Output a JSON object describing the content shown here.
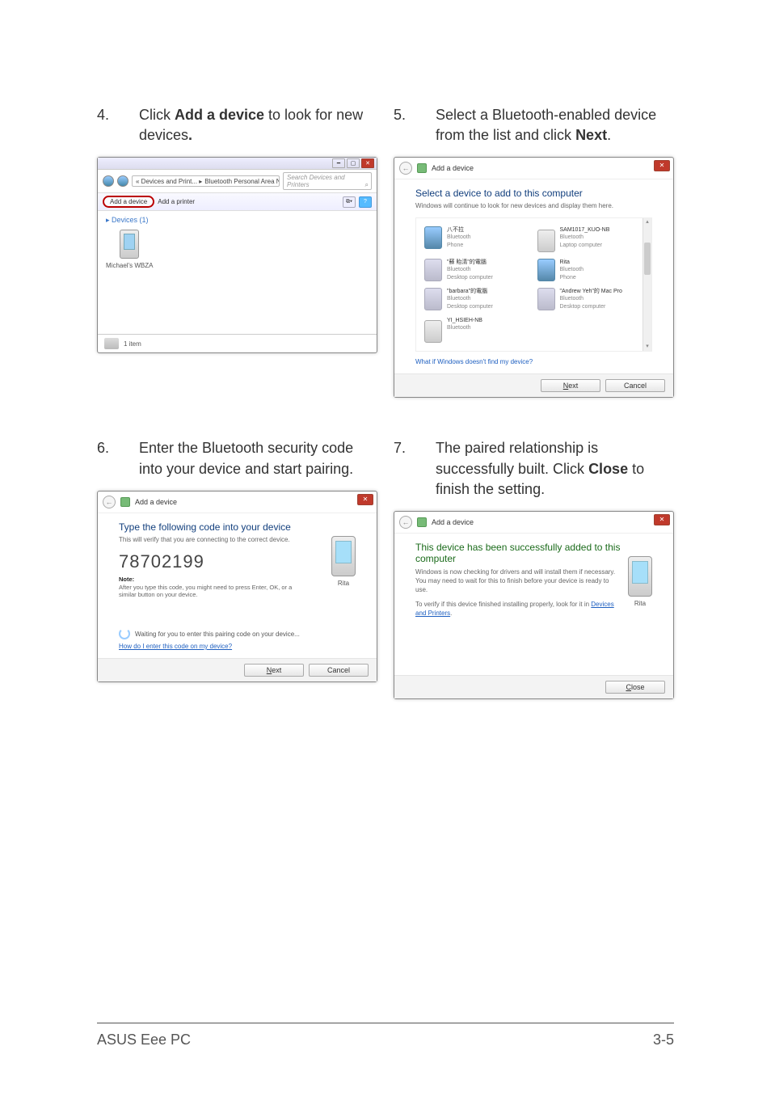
{
  "steps": {
    "s4": {
      "num": "4.",
      "pre": "Click ",
      "bold": "Add a device",
      "post": " to look for new devices",
      "punct": "."
    },
    "s5": {
      "num": "5.",
      "pre": "Select a Bluetooth-enabled device from the list and click ",
      "bold": "Next",
      "post": "."
    },
    "s6": {
      "num": "6.",
      "text": "Enter the Bluetooth security code into your device and start pairing."
    },
    "s7": {
      "num": "7.",
      "pre": "The paired relationship is successfully built. Click ",
      "bold": "Close",
      "post": " to finish the setting."
    }
  },
  "window4": {
    "breadcrumb_prefix": "« Devices and Print... ▸",
    "breadcrumb_item": "Bluetooth Personal Area Network Devices",
    "search_placeholder": "Search Devices and Printers",
    "toolbar_add_device": "Add a device",
    "toolbar_add_printer": "Add a printer",
    "devices_header": "▸ Devices (1)",
    "device_name": "Michael's WBZA",
    "status": "1 item"
  },
  "dialog5": {
    "title": "Add a device",
    "heading": "Select a device to add to this computer",
    "sub": "Windows will continue to look for new devices and display them here.",
    "help_link": "What if Windows doesn't find my device?",
    "next": "Next",
    "cancel": "Cancel",
    "devices": [
      {
        "l1": "八不拉",
        "l2": "Bluetooth",
        "l3": "Phone",
        "ico": "ico-phone"
      },
      {
        "l1": "SAM1017_KUO-NB",
        "l2": "Bluetooth",
        "l3": "Laptop computer",
        "ico": "ico-laptop"
      },
      {
        "l1": "\"蘇 貽清\"的電腦",
        "l2": "Bluetooth",
        "l3": "Desktop computer",
        "ico": "ico-desktop"
      },
      {
        "l1": "Rita",
        "l2": "Bluetooth",
        "l3": "Phone",
        "ico": "ico-phone"
      },
      {
        "l1": "\"barbara\"的電腦",
        "l2": "Bluetooth",
        "l3": "Desktop computer",
        "ico": "ico-desktop"
      },
      {
        "l1": "\"Andrew Yeh\"的 Mac Pro",
        "l2": "Bluetooth",
        "l3": "Desktop computer",
        "ico": "ico-desktop"
      },
      {
        "l1": "YI_HSIEH-NB",
        "l2": "Bluetooth",
        "l3": "",
        "ico": "ico-laptop"
      }
    ]
  },
  "dialog6": {
    "title": "Add a device",
    "heading": "Type the following code into your device",
    "sub": "This will verify that you are connecting to the correct device.",
    "code": "78702199",
    "note_label": "Note:",
    "note_text": "After you type this code, you might need to press Enter, OK, or a similar button on your device.",
    "waiting": "Waiting for you to enter this pairing code on your device...",
    "help_link": "How do I enter this code on my device?",
    "device_name": "Rita",
    "next": "Next",
    "cancel": "Cancel"
  },
  "dialog7": {
    "title": "Add a device",
    "heading": "This device has been successfully added to this computer",
    "info1": "Windows is now checking for drivers and will install them if necessary. You may need to wait for this to finish before your device is ready to use.",
    "info2_pre": "To verify if this device finished installing properly, look for it in ",
    "info2_link": "Devices and Printers",
    "device_name": "Rita",
    "close": "Close"
  },
  "footer": {
    "left": "ASUS Eee PC",
    "right": "3-5"
  }
}
